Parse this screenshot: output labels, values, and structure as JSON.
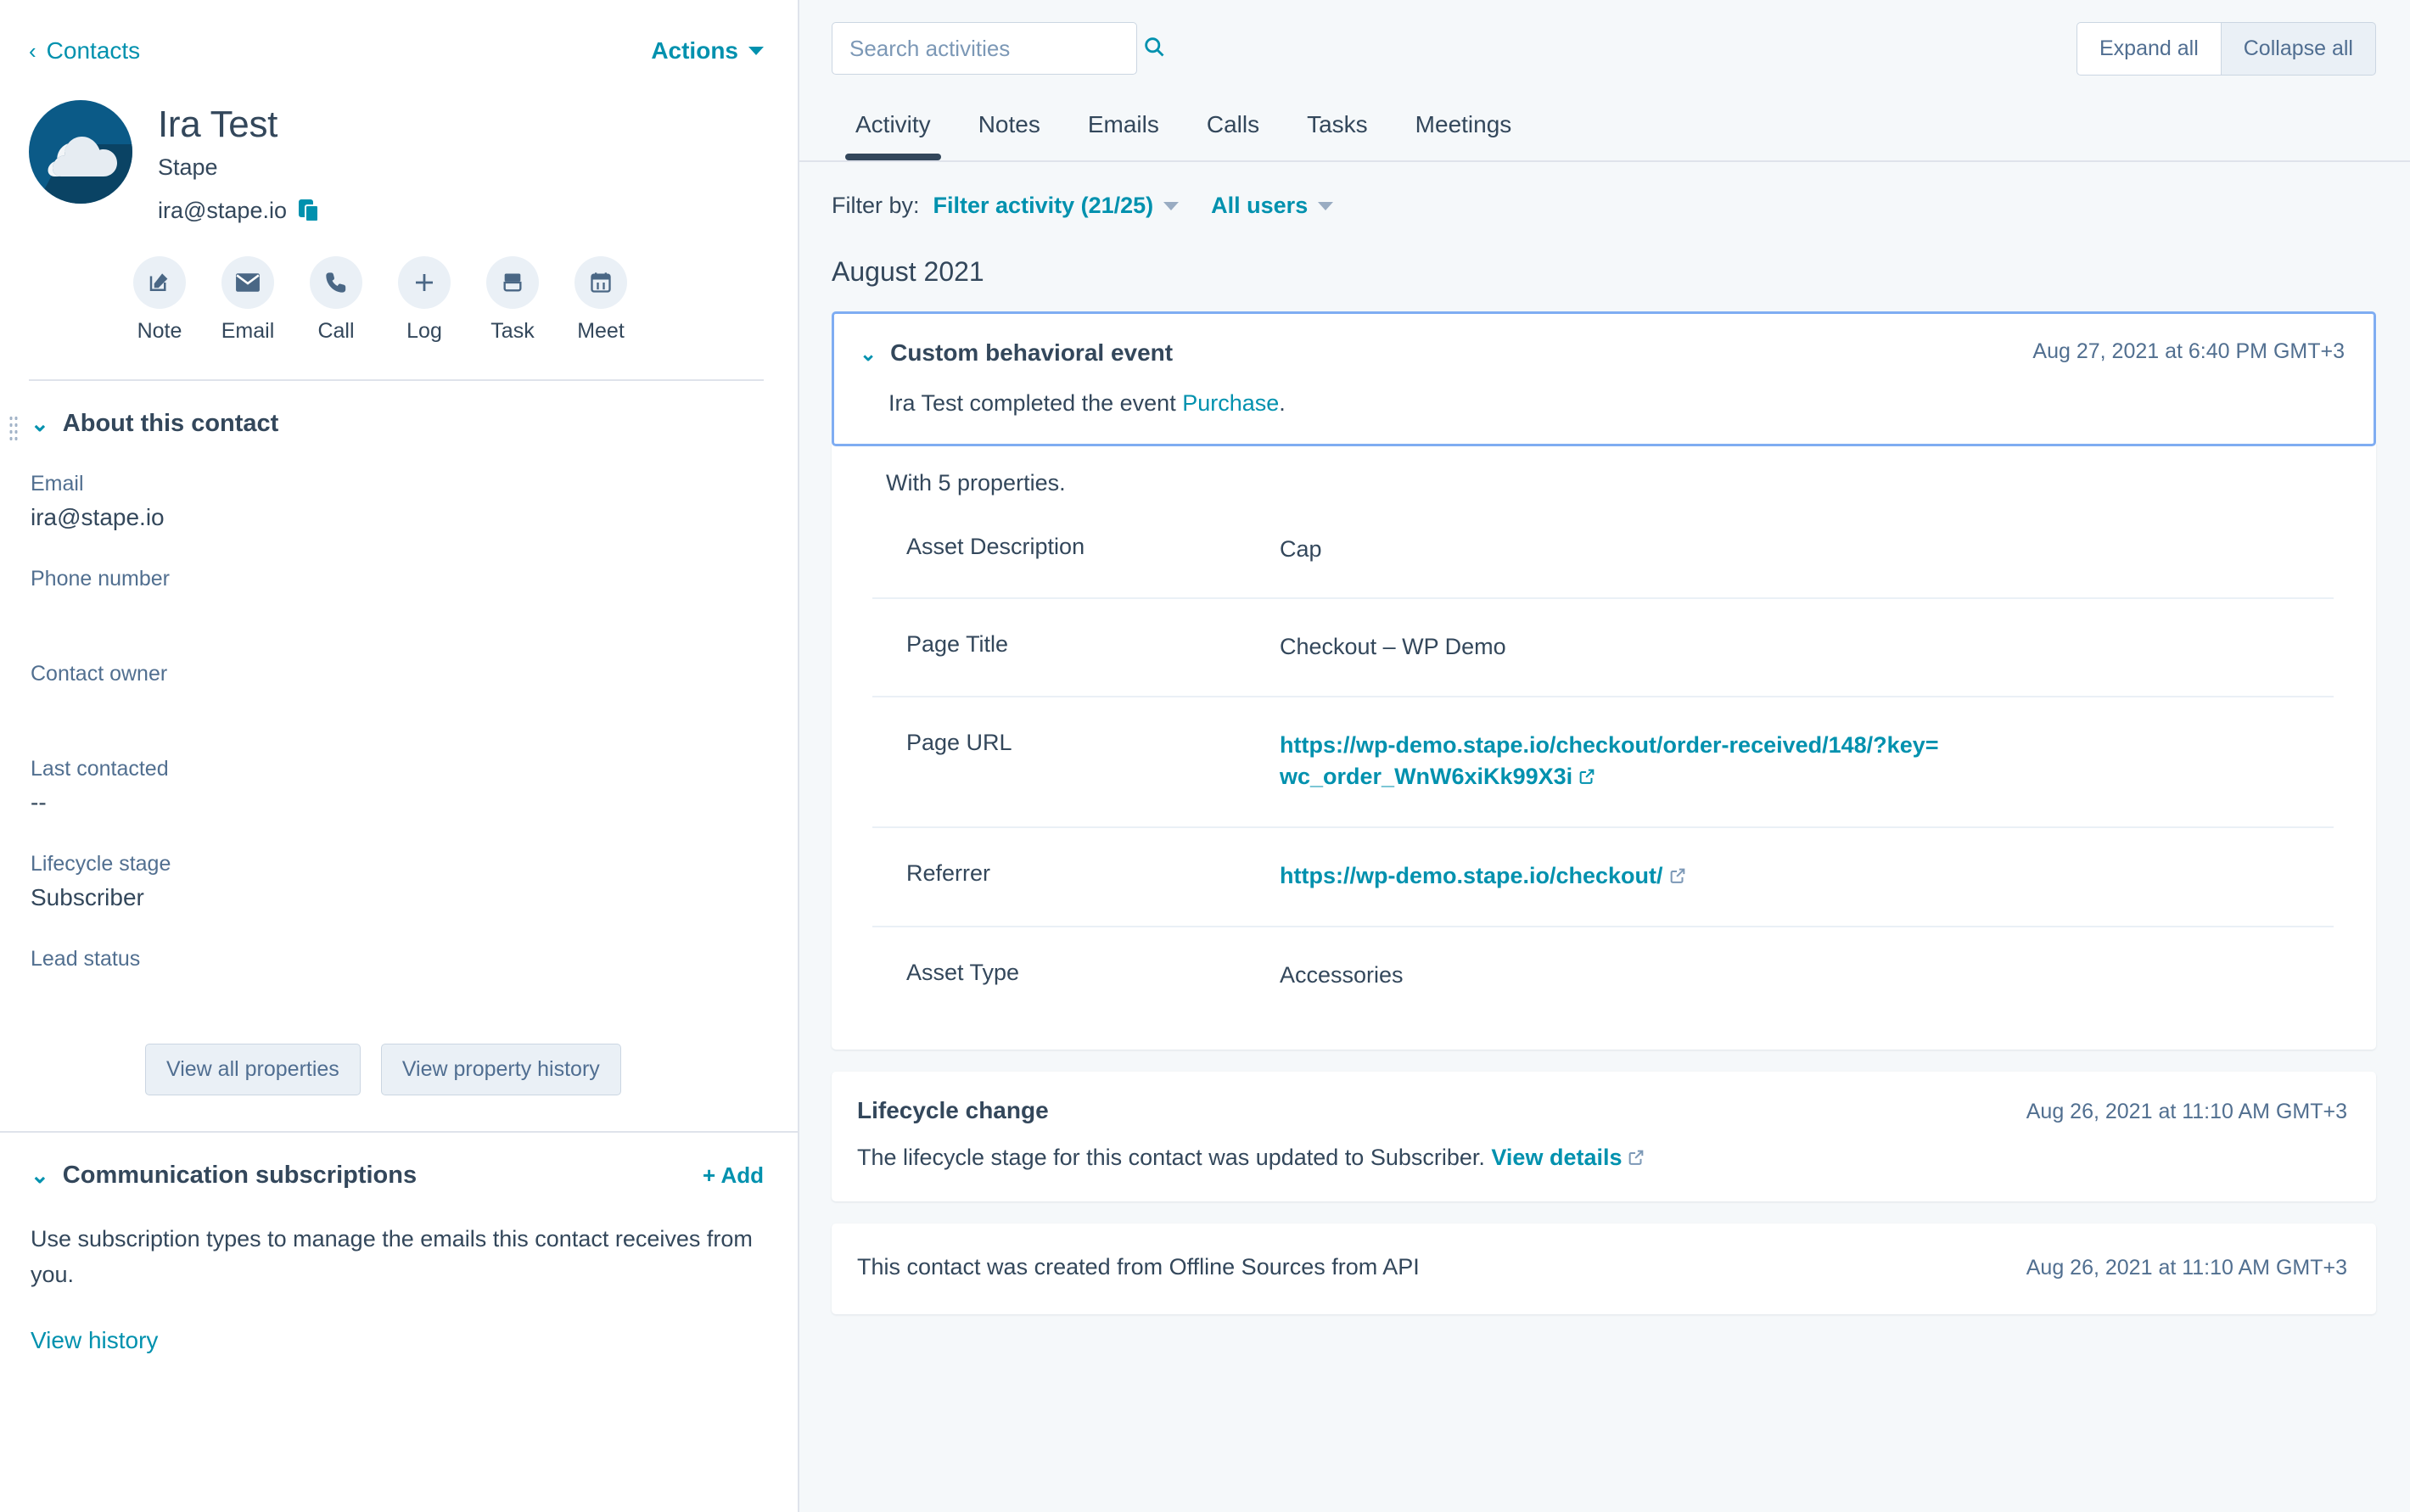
{
  "sidebar": {
    "back_label": "Contacts",
    "actions_label": "Actions",
    "contact": {
      "name": "Ira Test",
      "company": "Stape",
      "email": "ira@stape.io"
    },
    "quick_actions": [
      {
        "label": "Note",
        "icon": "note-pencil-icon"
      },
      {
        "label": "Email",
        "icon": "envelope-icon"
      },
      {
        "label": "Call",
        "icon": "phone-icon"
      },
      {
        "label": "Log",
        "icon": "plus-icon"
      },
      {
        "label": "Task",
        "icon": "task-icon"
      },
      {
        "label": "Meet",
        "icon": "calendar-icon"
      }
    ],
    "about": {
      "title": "About this contact",
      "properties": [
        {
          "label": "Email",
          "value": "ira@stape.io"
        },
        {
          "label": "Phone number",
          "value": ""
        },
        {
          "label": "Contact owner",
          "value": ""
        },
        {
          "label": "Last contacted",
          "value": "--"
        },
        {
          "label": "Lifecycle stage",
          "value": "Subscriber"
        },
        {
          "label": "Lead status",
          "value": ""
        }
      ],
      "view_all_properties": "View all properties",
      "view_property_history": "View property history"
    },
    "subscriptions": {
      "title": "Communication subscriptions",
      "add_label": "+ Add",
      "description": "Use subscription types to manage the emails this contact receives from you.",
      "view_history": "View history"
    }
  },
  "main": {
    "search": {
      "placeholder": "Search activities",
      "value": "",
      "icon": "search-icon"
    },
    "expand_all": "Expand all",
    "collapse_all": "Collapse all",
    "tabs": [
      {
        "label": "Activity",
        "active": true
      },
      {
        "label": "Notes",
        "active": false
      },
      {
        "label": "Emails",
        "active": false
      },
      {
        "label": "Calls",
        "active": false
      },
      {
        "label": "Tasks",
        "active": false
      },
      {
        "label": "Meetings",
        "active": false
      }
    ],
    "filter": {
      "label": "Filter by:",
      "activity_filter": "Filter activity (21/25)",
      "users_filter": "All users"
    },
    "month_heading": "August 2021",
    "event_card": {
      "title": "Custom behavioral event",
      "date": "Aug 27, 2021 at 6:40 PM GMT+3",
      "body_prefix": "Ira Test completed the event ",
      "body_link": "Purchase",
      "body_suffix": ".",
      "with_properties": "With 5 properties.",
      "properties": [
        {
          "key": "Asset Description",
          "value": "Cap",
          "is_link": false
        },
        {
          "key": "Page Title",
          "value": "Checkout – WP Demo",
          "is_link": false
        },
        {
          "key": "Page URL",
          "value": "https://wp-demo.stape.io/checkout/order-received/148/?key=wc_order_WnW6xiKk99X3i",
          "is_link": true
        },
        {
          "key": "Referrer",
          "value": "https://wp-demo.stape.io/checkout/",
          "is_link": true
        },
        {
          "key": "Asset Type",
          "value": "Accessories",
          "is_link": false
        }
      ]
    },
    "lifecycle_card": {
      "title": "Lifecycle change",
      "date": "Aug 26, 2021 at 11:10 AM GMT+3",
      "body_prefix": "The lifecycle stage for this contact was updated to Subscriber. ",
      "body_link": "View details"
    },
    "created_card": {
      "text": "This contact was created from Offline Sources from API",
      "date": "Aug 26, 2021 at 11:10 AM GMT+3"
    }
  },
  "colors": {
    "teal": "#0091ae",
    "navy": "#33475b",
    "panel_bg": "#f5f8fa",
    "highlight_border": "#7fadf2",
    "avatar_bg": "#0b5a87"
  }
}
